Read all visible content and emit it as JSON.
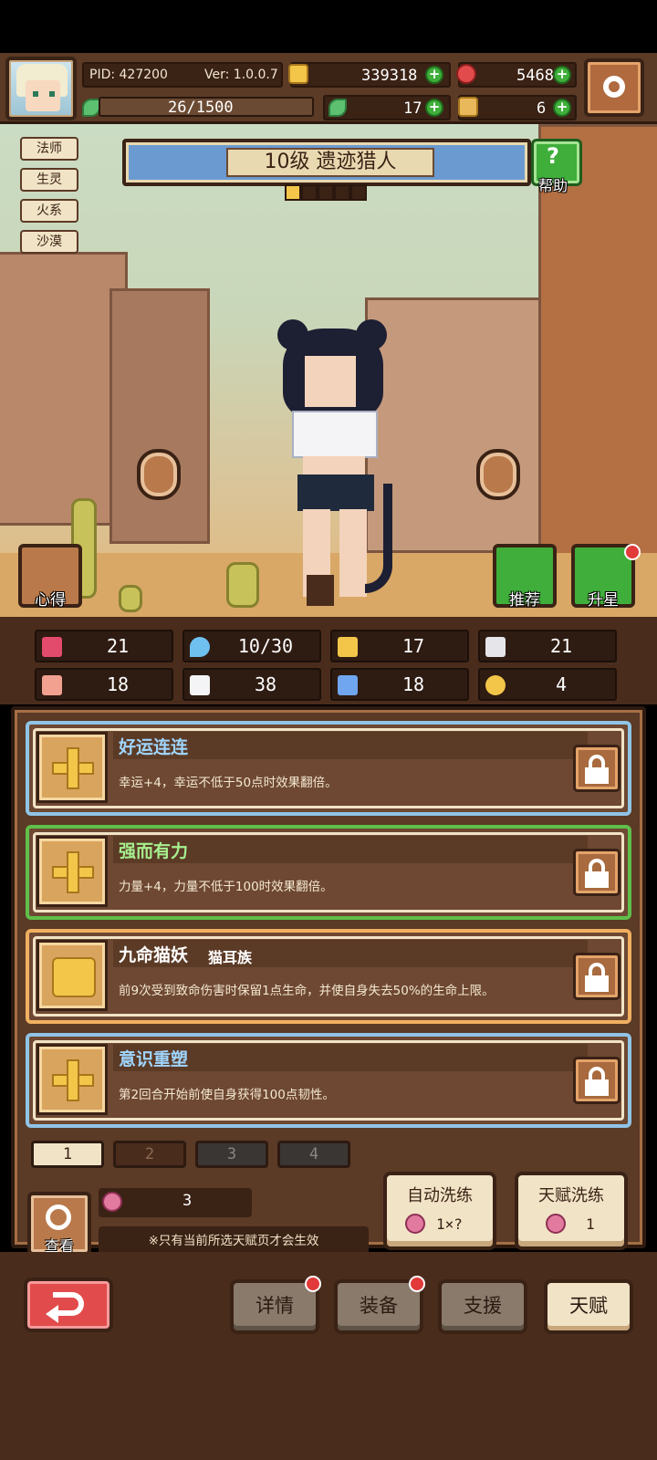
{
  "header": {
    "pid": "PID: 427200",
    "version": "Ver: 1.0.0.7",
    "gold": "339318",
    "gems": "5468",
    "exp": "26/1500",
    "clover": "17",
    "pet_food": "6"
  },
  "tags": [
    "法师",
    "生灵",
    "火系",
    "沙漠"
  ],
  "hero": {
    "title": "10级 遗迹猎人",
    "stars_filled": 1,
    "stars_total": 5,
    "help_label": "帮助",
    "insight_label": "心得",
    "recommend_label": "推荐",
    "upgrade_label": "升星"
  },
  "stats": [
    "21",
    "10/30",
    "17",
    "21",
    "18",
    "38",
    "18",
    "4"
  ],
  "talents": [
    {
      "name": "好运连连",
      "sub": "",
      "desc": "幸运+4，幸运不低于50点时效果翻倍。",
      "name_color": "#9fd6ff"
    },
    {
      "name": "强而有力",
      "sub": "",
      "desc": "力量+4，力量不低于100时效果翻倍。",
      "name_color": "#a6f08e"
    },
    {
      "name": "九命猫妖",
      "sub": "猫耳族",
      "desc": "前9次受到致命伤害时保留1点生命，并使自身失去50%的生命上限。",
      "name_color": "#ffffff"
    },
    {
      "name": "意识重塑",
      "sub": "",
      "desc": "第2回合开始前使自身获得100点韧性。",
      "name_color": "#9fd6ff"
    }
  ],
  "pages": [
    "1",
    "2",
    "3",
    "4"
  ],
  "controls": {
    "view_label": "查看",
    "peach_count": "3",
    "notice": "※只有当前所选天赋页才会生效",
    "auto_refine": "自动洗练",
    "auto_cost": "1×?",
    "talent_refine": "天赋洗练",
    "talent_cost": "1"
  },
  "nav": {
    "details": "详情",
    "equip": "装备",
    "support": "支援",
    "talent": "天赋"
  },
  "colors": {
    "blue_frame": "#8fc4e6",
    "green_frame": "#5fbf4a",
    "orange_frame": "#f0b060"
  }
}
